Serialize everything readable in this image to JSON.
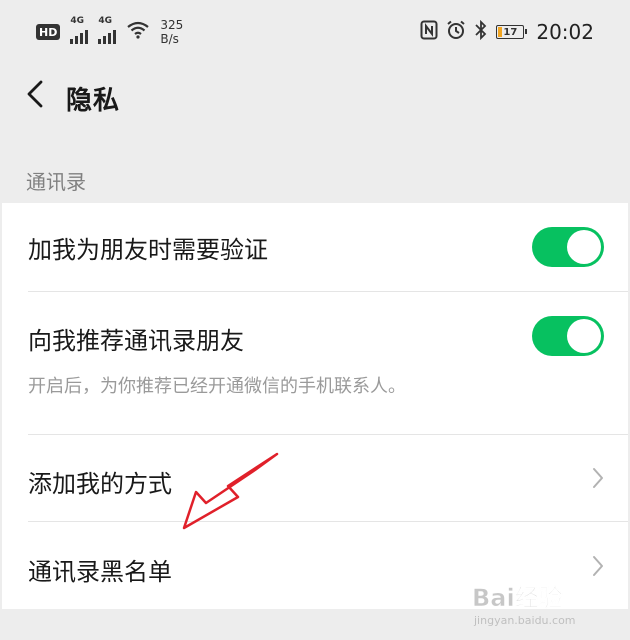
{
  "status_bar": {
    "hd_badge": "HD",
    "sim1_network": "4G",
    "sim2_network": "4G",
    "net_speed_value": "325",
    "net_speed_unit": "B/s",
    "battery_level": "17",
    "battery_color": "#f2a623",
    "time": "20:02",
    "icons": [
      "hd-icon",
      "signal-icon",
      "signal-icon",
      "wifi-icon",
      "nfc-icon",
      "alarm-icon",
      "bluetooth-icon",
      "battery-icon"
    ]
  },
  "nav": {
    "back_icon": "chevron-left-icon",
    "title": "隐私"
  },
  "section": {
    "header": "通讯录"
  },
  "settings": {
    "items": [
      {
        "label": "加我为朋友时需要验证",
        "type": "toggle",
        "on": true
      },
      {
        "label": "向我推荐通讯录朋友",
        "type": "toggle",
        "on": true,
        "description": "开启后，为你推荐已经开通微信的手机联系人。"
      },
      {
        "label": "添加我的方式",
        "type": "link",
        "icon": "chevron-right-icon"
      },
      {
        "label": "通讯录黑名单",
        "type": "link",
        "icon": "chevron-right-icon"
      }
    ]
  },
  "colors": {
    "accent_green": "#07c160",
    "annotation_red": "#e0202a",
    "background": "#ededed"
  },
  "watermark": {
    "text": "Bai经验",
    "subtext": "jingyan.baidu.com"
  }
}
